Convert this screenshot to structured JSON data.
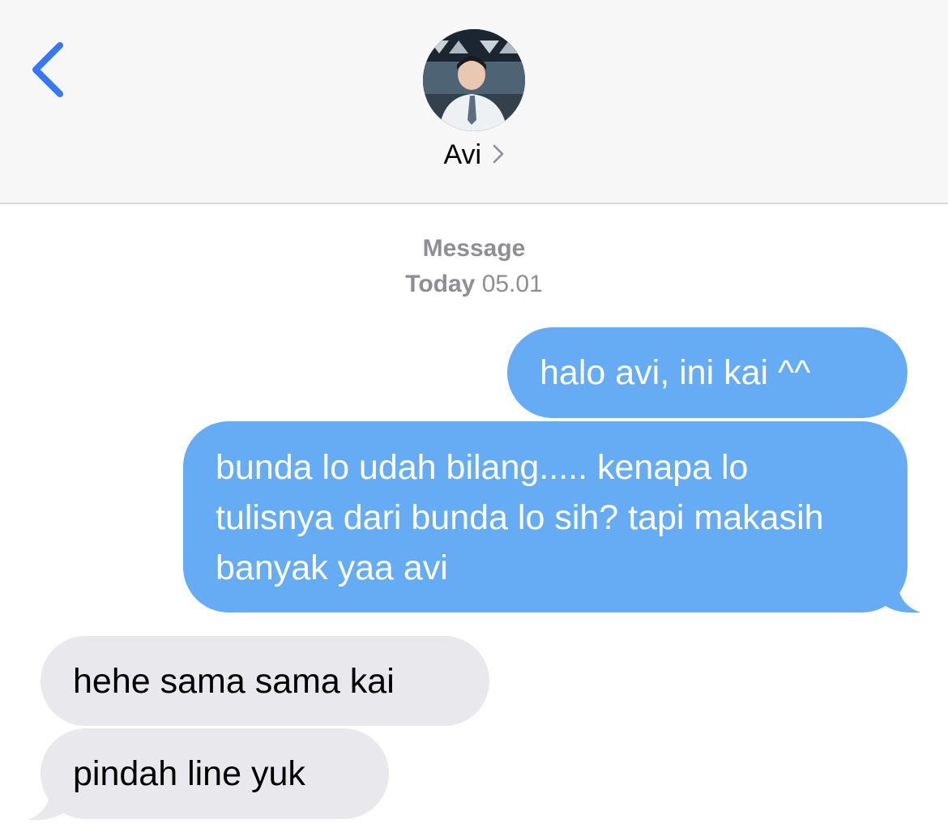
{
  "header": {
    "contact_name": "Avi"
  },
  "thread": {
    "label": "Message",
    "timestamp_day": "Today",
    "timestamp_time": "05.01"
  },
  "messages": [
    {
      "direction": "outgoing",
      "text": "halo avi, ini kai ^^"
    },
    {
      "direction": "outgoing",
      "text": "bunda lo udah bilang..... kenapa lo tulisnya dari bunda lo sih? tapi makasih banyak yaa avi"
    },
    {
      "direction": "incoming",
      "text": "hehe sama sama kai"
    },
    {
      "direction": "incoming",
      "text": "pindah line yuk"
    }
  ],
  "icons": {
    "back": "chevron-left-icon",
    "contact_chevron": "chevron-right-icon"
  },
  "colors": {
    "accent": "#3478f6",
    "outgoing_bubble": "#65acf4",
    "incoming_bubble": "#e8e8ed",
    "meta_text": "#8e8e93"
  }
}
